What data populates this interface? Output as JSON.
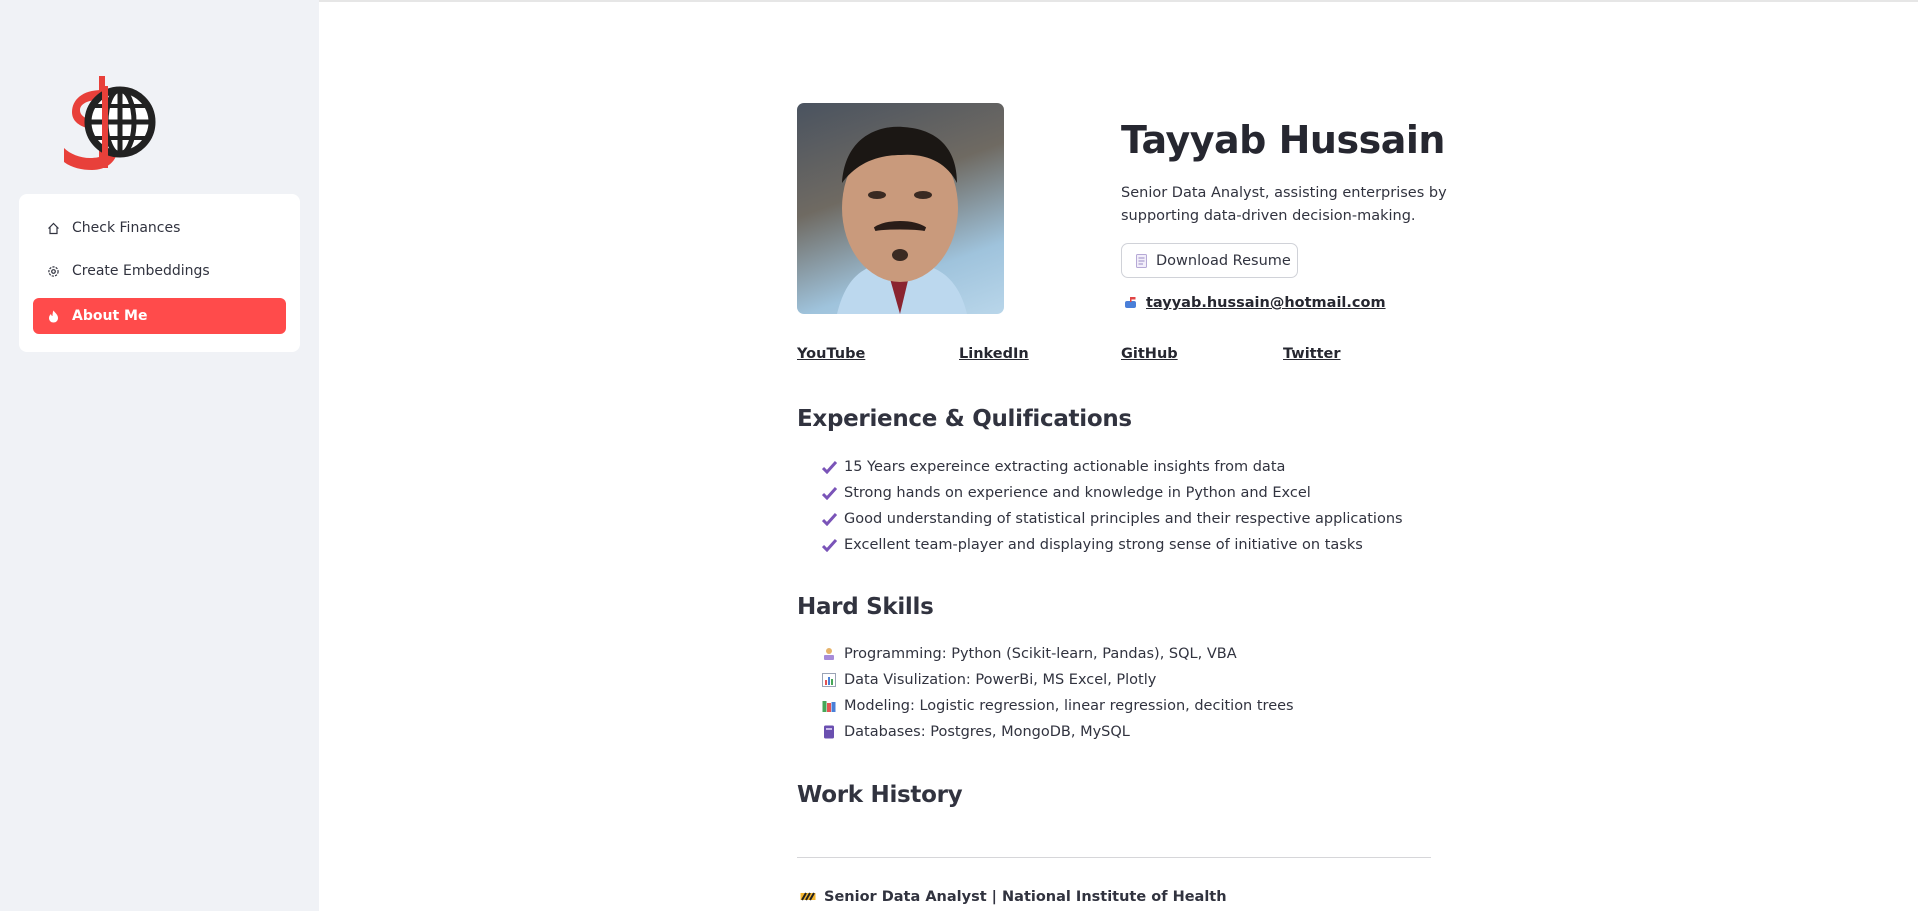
{
  "sidebar": {
    "items": [
      {
        "label": "Check Finances",
        "icon": "home-icon"
      },
      {
        "label": "Create Embeddings",
        "icon": "gear-icon"
      },
      {
        "label": "About Me",
        "icon": "fire-icon"
      }
    ],
    "accent": "#ff4b4b"
  },
  "profile": {
    "name": "Tayyab Hussain",
    "tagline": "Senior Data Analyst, assisting enterprises by supporting data-driven decision-making.",
    "download_label": "Download Resume",
    "email": "tayyab.hussain@hotmail.com"
  },
  "links": [
    {
      "label": "YouTube"
    },
    {
      "label": "LinkedIn"
    },
    {
      "label": "GitHub"
    },
    {
      "label": "Twitter"
    }
  ],
  "experience": {
    "heading": "Experience & Qulifications",
    "items": [
      "15 Years expereince extracting actionable insights from data",
      "Strong hands on experience and knowledge in Python and Excel",
      "Good understanding of statistical principles and their respective applications",
      "Excellent team-player and displaying strong sense of initiative on tasks"
    ]
  },
  "skills": {
    "heading": "Hard Skills",
    "items": [
      {
        "text": "Programming: Python (Scikit-learn, Pandas), SQL, VBA",
        "icon": "technologist-icon"
      },
      {
        "text": "Data Visulization: PowerBi, MS Excel, Plotly",
        "icon": "bar-chart-icon"
      },
      {
        "text": "Modeling: Logistic regression, linear regression, decition trees",
        "icon": "books-icon"
      },
      {
        "text": "Databases: Postgres, MongoDB, MySQL",
        "icon": "database-icon"
      }
    ]
  },
  "work": {
    "heading": "Work History",
    "jobs": [
      {
        "title": "Senior Data Analyst | National Institute of Health",
        "icon": "construction-icon"
      }
    ]
  }
}
